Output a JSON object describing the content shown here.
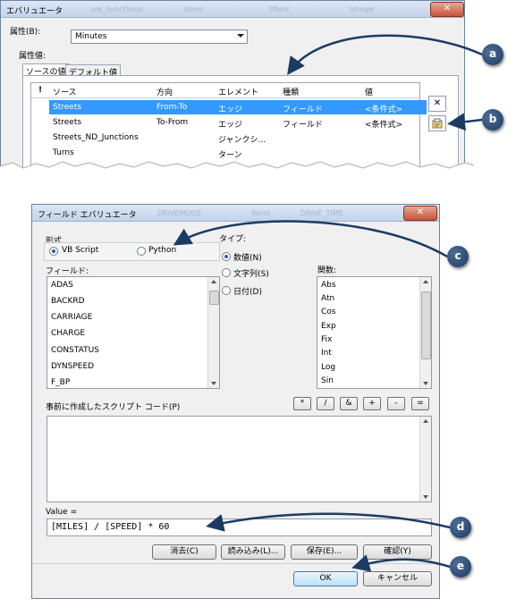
{
  "attr_eval": {
    "title": "エバリュエータ",
    "close_label": "✕",
    "ghost": [
      "ure_SyncFields",
      "Iteml",
      "Pfield",
      "Integer"
    ],
    "attribute_label": "属性(B):",
    "attribute_value": "Minutes",
    "values_label": "属性値:",
    "tabs": [
      "ソースの値",
      "デフォルト値"
    ],
    "columns": [
      "!",
      "ソース",
      "方向",
      "エレメント",
      "種類",
      "値"
    ],
    "rows": [
      {
        "source": "Streets",
        "direction": "From-To",
        "element": "エッジ",
        "type": "フィールド",
        "value": "<条件式>"
      },
      {
        "source": "Streets",
        "direction": "To-From",
        "element": "エッジ",
        "type": "フィールド",
        "value": "<条件式>"
      },
      {
        "source": "Streets_ND_Junctions",
        "direction": "",
        "element": "ジャンクシ...",
        "type": "",
        "value": ""
      },
      {
        "source": "Turns",
        "direction": "",
        "element": "ターン",
        "type": "",
        "value": ""
      }
    ],
    "delete_icon": "✕"
  },
  "field_eval": {
    "title": "フィールド エバリュエータ",
    "close_label": "✕",
    "ghost": [
      "DRIVEMODE",
      "Iteml",
      "DRIVE_TIME"
    ],
    "format_label": "形式",
    "vbscript_label": "VB Script",
    "python_label": "Python",
    "type_label": "タイプ:",
    "type_options": [
      "数値(N)",
      "文字列(S)",
      "日付(D)"
    ],
    "fields_label": "フィールド:",
    "fields": [
      "ADAS",
      "BACKRD",
      "CARRIAGE",
      "CHARGE",
      "CONSTATUS",
      "DYNSPEED",
      "F_BP"
    ],
    "functions_label": "関数:",
    "functions": [
      "Abs",
      "Atn",
      "Cos",
      "Exp",
      "Fix",
      "Int",
      "Log",
      "Sin"
    ],
    "script_label": "事前に作成したスクリプト コード(P)",
    "operators": [
      "*",
      "/",
      "&",
      "+",
      "-",
      "="
    ],
    "value_label": "Value =",
    "expression": "[MILES] / [SPEED] * 60",
    "buttons": {
      "clear": "消去(C)",
      "load": "読み込み(L)...",
      "save": "保存(E)...",
      "verify": "確認(Y)",
      "ok": "OK",
      "cancel": "キャンセル"
    }
  },
  "callouts": [
    "a",
    "b",
    "c",
    "d",
    "e"
  ]
}
